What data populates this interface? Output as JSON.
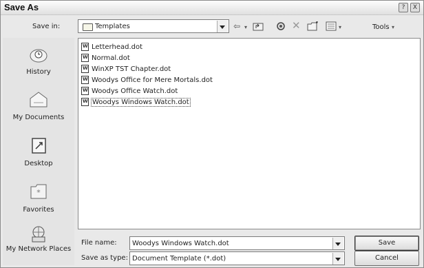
{
  "window": {
    "title": "Save As",
    "help_button": "?",
    "close_button": "X"
  },
  "toolbar": {
    "save_in_label": "Save in:",
    "save_in_value": "Templates",
    "tools_label": "Tools"
  },
  "places": [
    {
      "label": "History",
      "icon": "history-icon"
    },
    {
      "label": "My Documents",
      "icon": "my-documents-icon"
    },
    {
      "label": "Desktop",
      "icon": "desktop-icon"
    },
    {
      "label": "Favorites",
      "icon": "favorites-icon"
    },
    {
      "label": "My Network Places",
      "icon": "network-places-icon"
    }
  ],
  "files": [
    {
      "name": "Letterhead.dot"
    },
    {
      "name": "Normal.dot"
    },
    {
      "name": "WinXP TST Chapter.dot"
    },
    {
      "name": "Woodys Office for Mere Mortals.dot"
    },
    {
      "name": "Woodys Office Watch.dot"
    },
    {
      "name": "Woodys Windows Watch.dot",
      "selected": true
    }
  ],
  "bottom": {
    "file_name_label": "File name:",
    "file_name_value": "Woodys Windows Watch.dot",
    "save_as_type_label": "Save as type:",
    "save_as_type_value": "Document Template (*.dot)",
    "save_button": "Save",
    "cancel_button": "Cancel"
  }
}
